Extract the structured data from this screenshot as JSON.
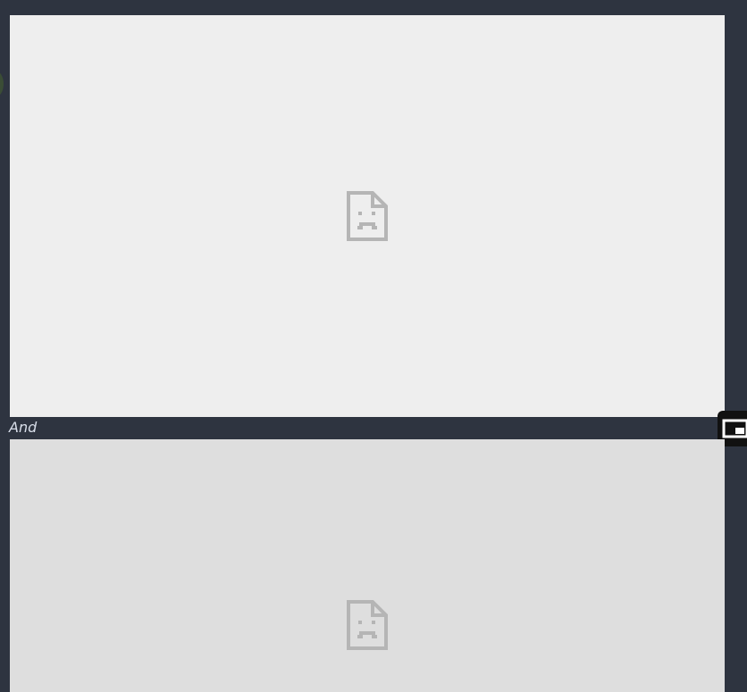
{
  "content": {
    "top_frame": {
      "status_icon": "broken-page-icon"
    },
    "caption": "And",
    "bottom_frame": {
      "status_icon": "broken-page-icon"
    }
  },
  "controls": {
    "pip_icon": "picture-in-picture-icon"
  },
  "colors": {
    "page_background": "#2e3440",
    "top_frame_background": "#eeeeee",
    "bottom_frame_background": "#dedede",
    "caption_text": "#d8dee9",
    "broken_icon": "#b5b5b5",
    "pip_background": "#111111"
  }
}
